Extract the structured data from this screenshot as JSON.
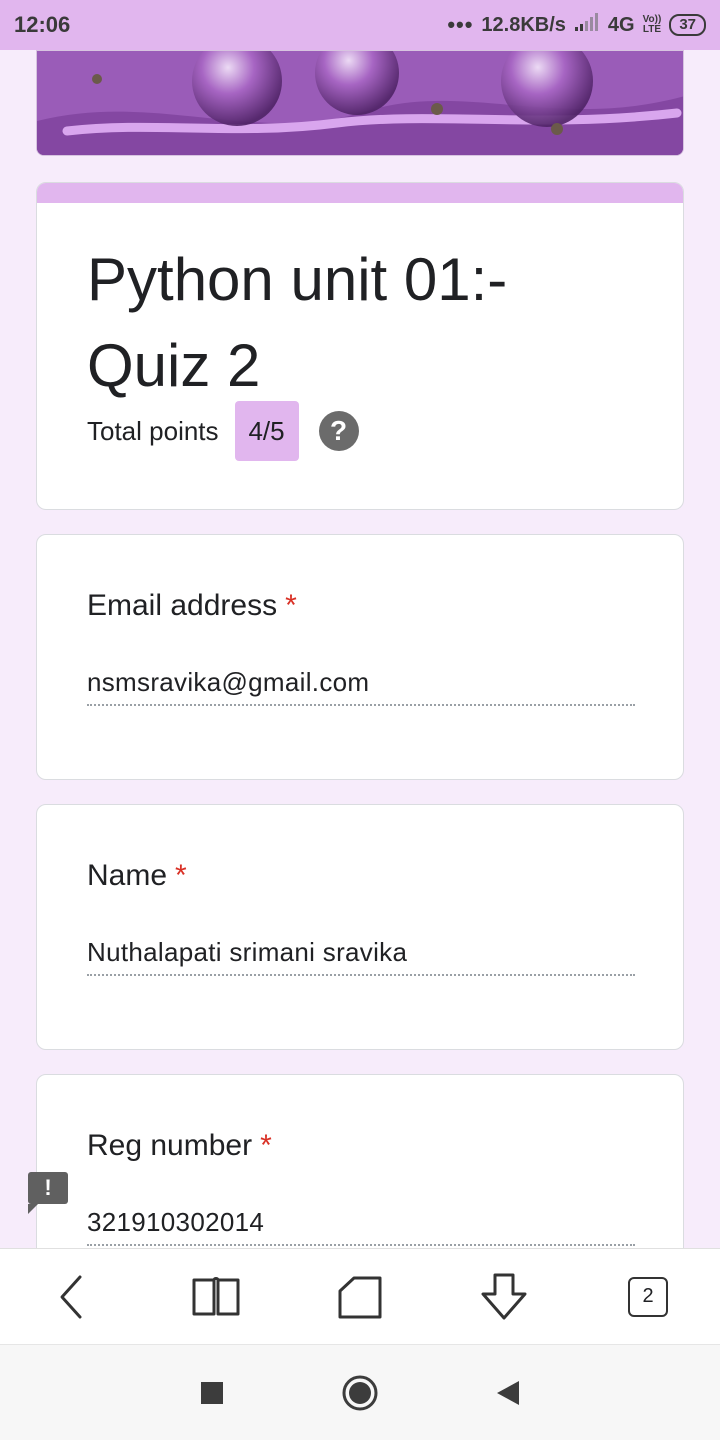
{
  "status_bar": {
    "time": "12:06",
    "dots": "•••",
    "speed": "12.8KB/s",
    "network": "4G",
    "volte_top": "Vo))",
    "volte_bottom": "LTE",
    "battery": "37"
  },
  "form": {
    "title": "Python unit 01:- Quiz 2",
    "points_label": "Total points",
    "points_value": "4/5",
    "help_symbol": "?",
    "accent_color": "#e1b6ee",
    "questions": [
      {
        "label": "Email address",
        "required_mark": "*",
        "value": "nsmsravika@gmail.com"
      },
      {
        "label": "Name",
        "required_mark": "*",
        "value": "Nuthalapati srimani sravika"
      },
      {
        "label": "Reg number",
        "required_mark": "*",
        "value": "321910302014"
      }
    ]
  },
  "feedback": {
    "symbol": "!"
  },
  "browser_toolbar": {
    "tabs_count": "2",
    "icons": [
      "back-icon",
      "bookmarks-book-icon",
      "home-icon",
      "download-icon",
      "tabs-icon"
    ]
  },
  "system_nav": {
    "icons": [
      "recents-square-icon",
      "home-circle-icon",
      "back-triangle-icon"
    ]
  }
}
